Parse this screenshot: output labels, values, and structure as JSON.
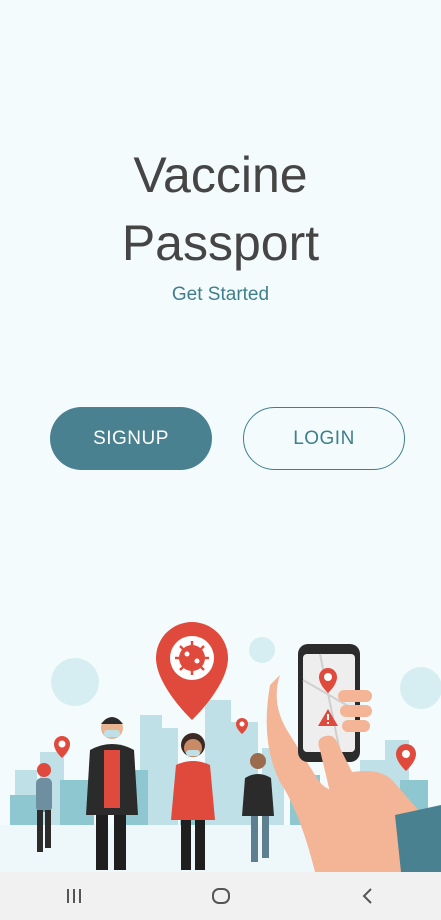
{
  "app": {
    "title_line1": "Vaccine",
    "title_line2": "Passport",
    "subtitle": "Get Started"
  },
  "buttons": {
    "signup_label": "SIGNUP",
    "login_label": "LOGIN"
  },
  "colors": {
    "background": "#f4fbfd",
    "accent": "#4a8190",
    "accent_text": "#3f7f8c",
    "title": "#454545",
    "nav_bar": "#f1f1f1",
    "marker_red": "#e04a3c"
  },
  "illustration": {
    "subject": "people-walking-with-masks-and-phone-map",
    "icons": [
      "virus-location-pin-icon",
      "location-pin-icon",
      "warning-icon",
      "smartphone-icon",
      "hand-icon"
    ]
  },
  "navbar": {
    "icons": [
      "recent-apps-icon",
      "home-icon",
      "back-icon"
    ]
  }
}
